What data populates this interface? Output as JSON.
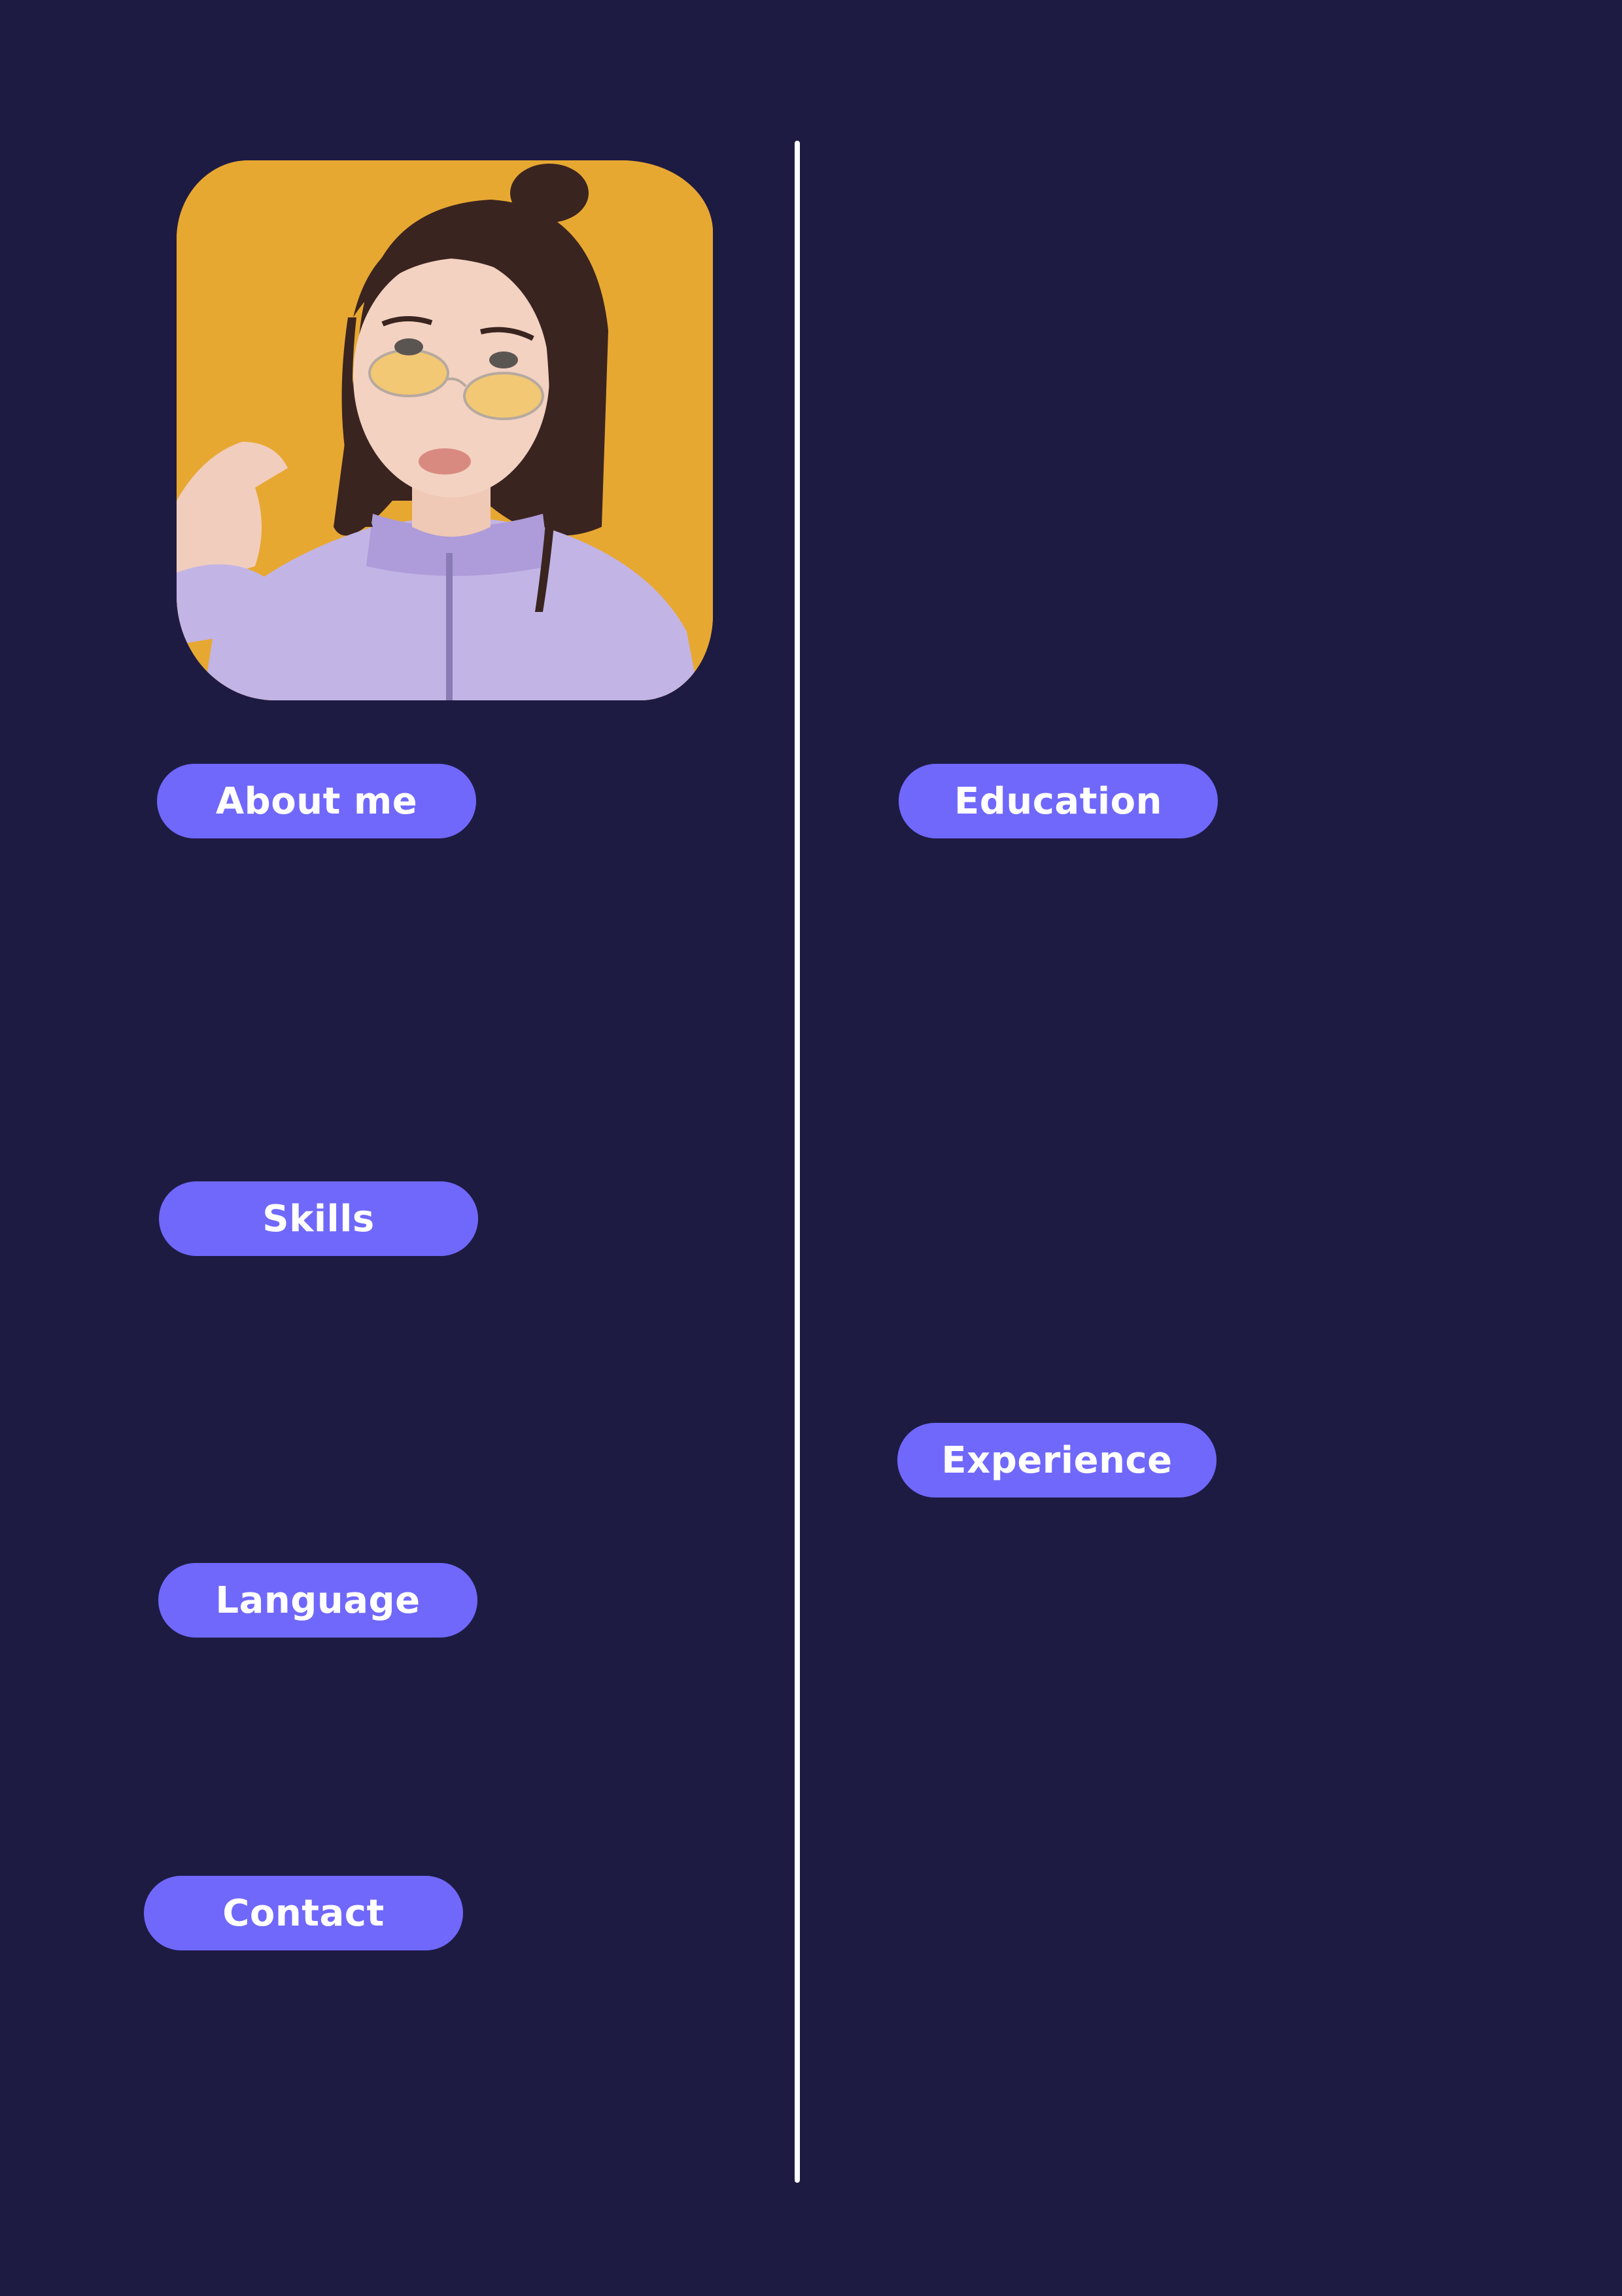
{
  "sections": {
    "left": {
      "about": "About me",
      "skills": "Skills",
      "language": "Language",
      "contact": "Contact"
    },
    "right": {
      "education": "Education",
      "experience": "Experience"
    }
  },
  "colors": {
    "background": "#1e1b43",
    "pill": "#7068fb",
    "pill_text": "#ffffff",
    "divider": "#ffffff",
    "photo_background": "#e7a832"
  },
  "photo": {
    "icon": "profile-photo"
  }
}
